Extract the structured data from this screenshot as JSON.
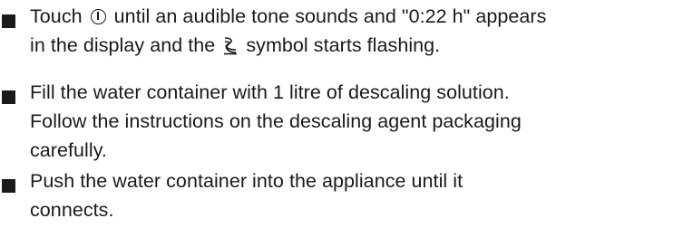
{
  "instructions": {
    "items": [
      {
        "lines": [
          {
            "segments": [
              {
                "text": "Touch "
              },
              {
                "icon": "power-icon"
              },
              {
                "text": " until an audible tone sounds and \"0:22 h\" appears"
              }
            ]
          },
          {
            "segments": [
              {
                "text": "in the display and the "
              },
              {
                "icon": "descale-icon"
              },
              {
                "text": " symbol starts flashing."
              }
            ]
          }
        ]
      },
      {
        "lines": [
          {
            "segments": [
              {
                "text": "Fill the water container with 1 litre of descaling solution."
              }
            ]
          },
          {
            "segments": [
              {
                "text": "Follow the instructions on the descaling agent packaging"
              }
            ]
          },
          {
            "segments": [
              {
                "text": "carefully."
              }
            ]
          }
        ]
      },
      {
        "lines": [
          {
            "segments": [
              {
                "text": "Push the water container into the appliance until it"
              }
            ]
          },
          {
            "segments": [
              {
                "text": "connects."
              }
            ]
          }
        ]
      }
    ]
  },
  "colors": {
    "text": "#1a1a1a",
    "background": "#ffffff"
  }
}
